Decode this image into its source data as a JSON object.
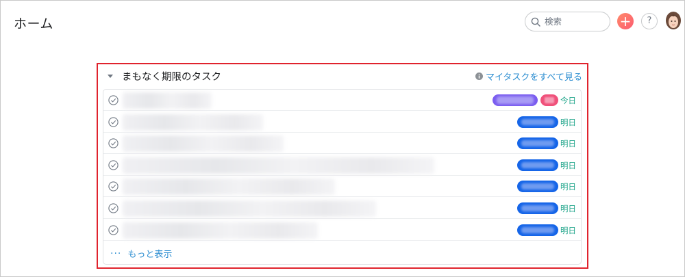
{
  "header": {
    "page_title": "ホーム",
    "search_placeholder": "検索",
    "add_icon": "plus-icon",
    "help_label": "?",
    "accent": "#fc636f"
  },
  "card": {
    "title": "まもなく期限のタスク",
    "all_link": "マイタスクをすべて見る",
    "more_link": "もっと表示",
    "more_dots": "···",
    "tasks": [
      {
        "due": "今日",
        "tags": [
          "purple",
          "pink"
        ]
      },
      {
        "due": "明日",
        "tags": [
          "blue"
        ]
      },
      {
        "due": "明日",
        "tags": [
          "blue"
        ]
      },
      {
        "due": "明日",
        "tags": [
          "blue"
        ]
      },
      {
        "due": "明日",
        "tags": [
          "blue"
        ]
      },
      {
        "due": "明日",
        "tags": [
          "blue"
        ]
      },
      {
        "due": "明日",
        "tags": [
          "blue"
        ]
      }
    ]
  },
  "colors": {
    "highlight": "#e0232d",
    "link": "#2d8ed1",
    "due": "#25a78d",
    "tag_blue": "#1565e8",
    "tag_purple": "#7a5cf0",
    "tag_pink": "#f0507a"
  }
}
